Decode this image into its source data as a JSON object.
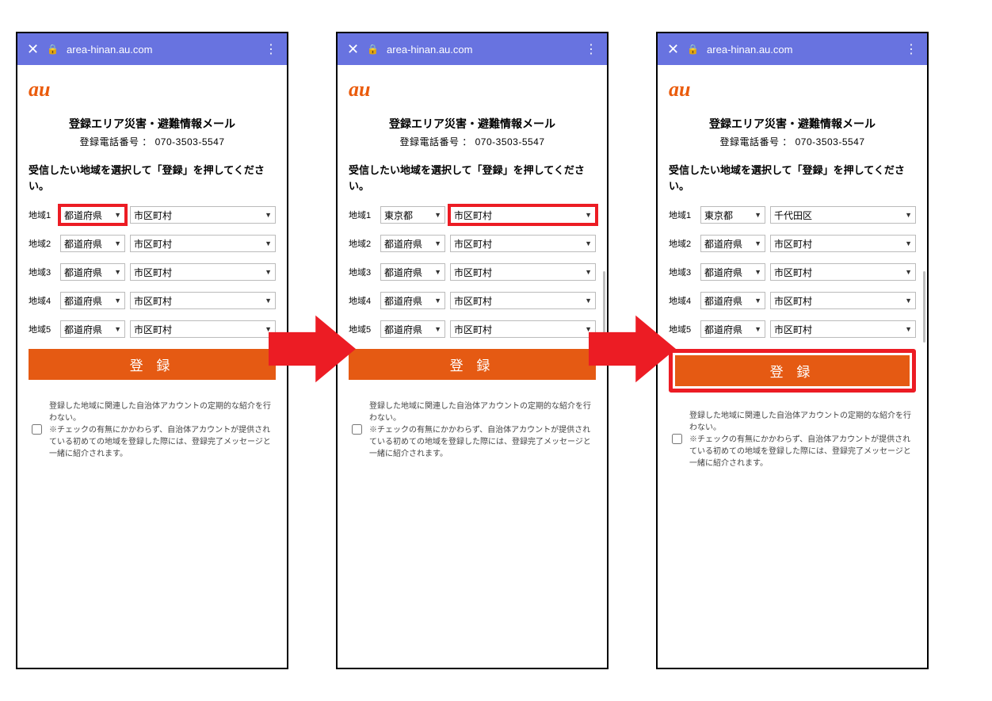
{
  "browser": {
    "url": "area-hinan.au.com",
    "close_glyph": "✕",
    "lock_glyph": "🔒",
    "menu_glyph": "⋮"
  },
  "logo_text": "au",
  "service_title": "登録エリア災害・避難情報メール",
  "phone_label": "登録電話番号 ：",
  "phone_number": "070-3503-5547",
  "instruction": "受信したい地域を選択して「登録」を押してください。",
  "region_labels": [
    "地域1",
    "地域2",
    "地域3",
    "地域4",
    "地域5"
  ],
  "default_pref": "都道府県",
  "default_city": "市区町村",
  "selected_pref": "東京都",
  "selected_city": "千代田区",
  "register_button": "登 録",
  "checkbox_text": "登録した地域に関連した自治体アカウントの定期的な紹介を行わない。",
  "checkbox_note": "※チェックの有無にかかわらず、自治体アカウントが提供されている初めての地域を登録した際には、登録完了メッセージと一緒に紹介されます。",
  "screens": [
    {
      "rows": [
        {
          "pref": "都道府県",
          "city": "市区町村",
          "hl": "pref"
        },
        {
          "pref": "都道府県",
          "city": "市区町村"
        },
        {
          "pref": "都道府県",
          "city": "市区町村"
        },
        {
          "pref": "都道府県",
          "city": "市区町村"
        },
        {
          "pref": "都道府県",
          "city": "市区町村"
        }
      ],
      "hl_button": false
    },
    {
      "rows": [
        {
          "pref": "東京都",
          "city": "市区町村",
          "hl": "city"
        },
        {
          "pref": "都道府県",
          "city": "市区町村"
        },
        {
          "pref": "都道府県",
          "city": "市区町村"
        },
        {
          "pref": "都道府県",
          "city": "市区町村"
        },
        {
          "pref": "都道府県",
          "city": "市区町村"
        }
      ],
      "hl_button": false,
      "scroll": true
    },
    {
      "rows": [
        {
          "pref": "東京都",
          "city": "千代田区"
        },
        {
          "pref": "都道府県",
          "city": "市区町村"
        },
        {
          "pref": "都道府県",
          "city": "市区町村"
        },
        {
          "pref": "都道府県",
          "city": "市区町村"
        },
        {
          "pref": "都道府県",
          "city": "市区町村"
        }
      ],
      "hl_button": true,
      "scroll": true
    }
  ]
}
